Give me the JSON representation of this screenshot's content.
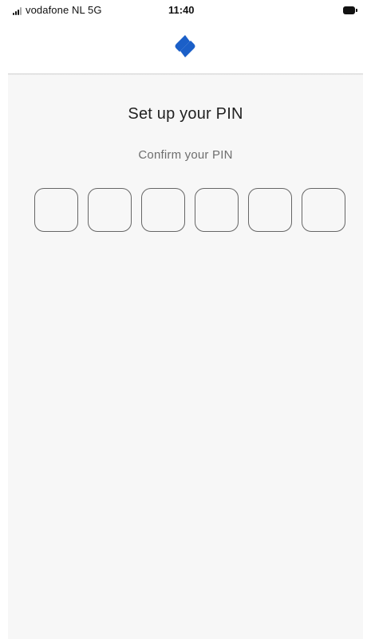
{
  "status_bar": {
    "carrier": "vodafone NL  5G",
    "time": "11:40",
    "signal_icon": "signal-bars-icon",
    "battery_icon": "battery-icon"
  },
  "header": {
    "logo_icon": "app-logo-icon",
    "brand_color": "#1b5fc8"
  },
  "pin_setup": {
    "title": "Set up your PIN",
    "subtitle": "Confirm your PIN",
    "digit_count": 6,
    "digits": [
      "",
      "",
      "",
      "",
      "",
      ""
    ]
  }
}
